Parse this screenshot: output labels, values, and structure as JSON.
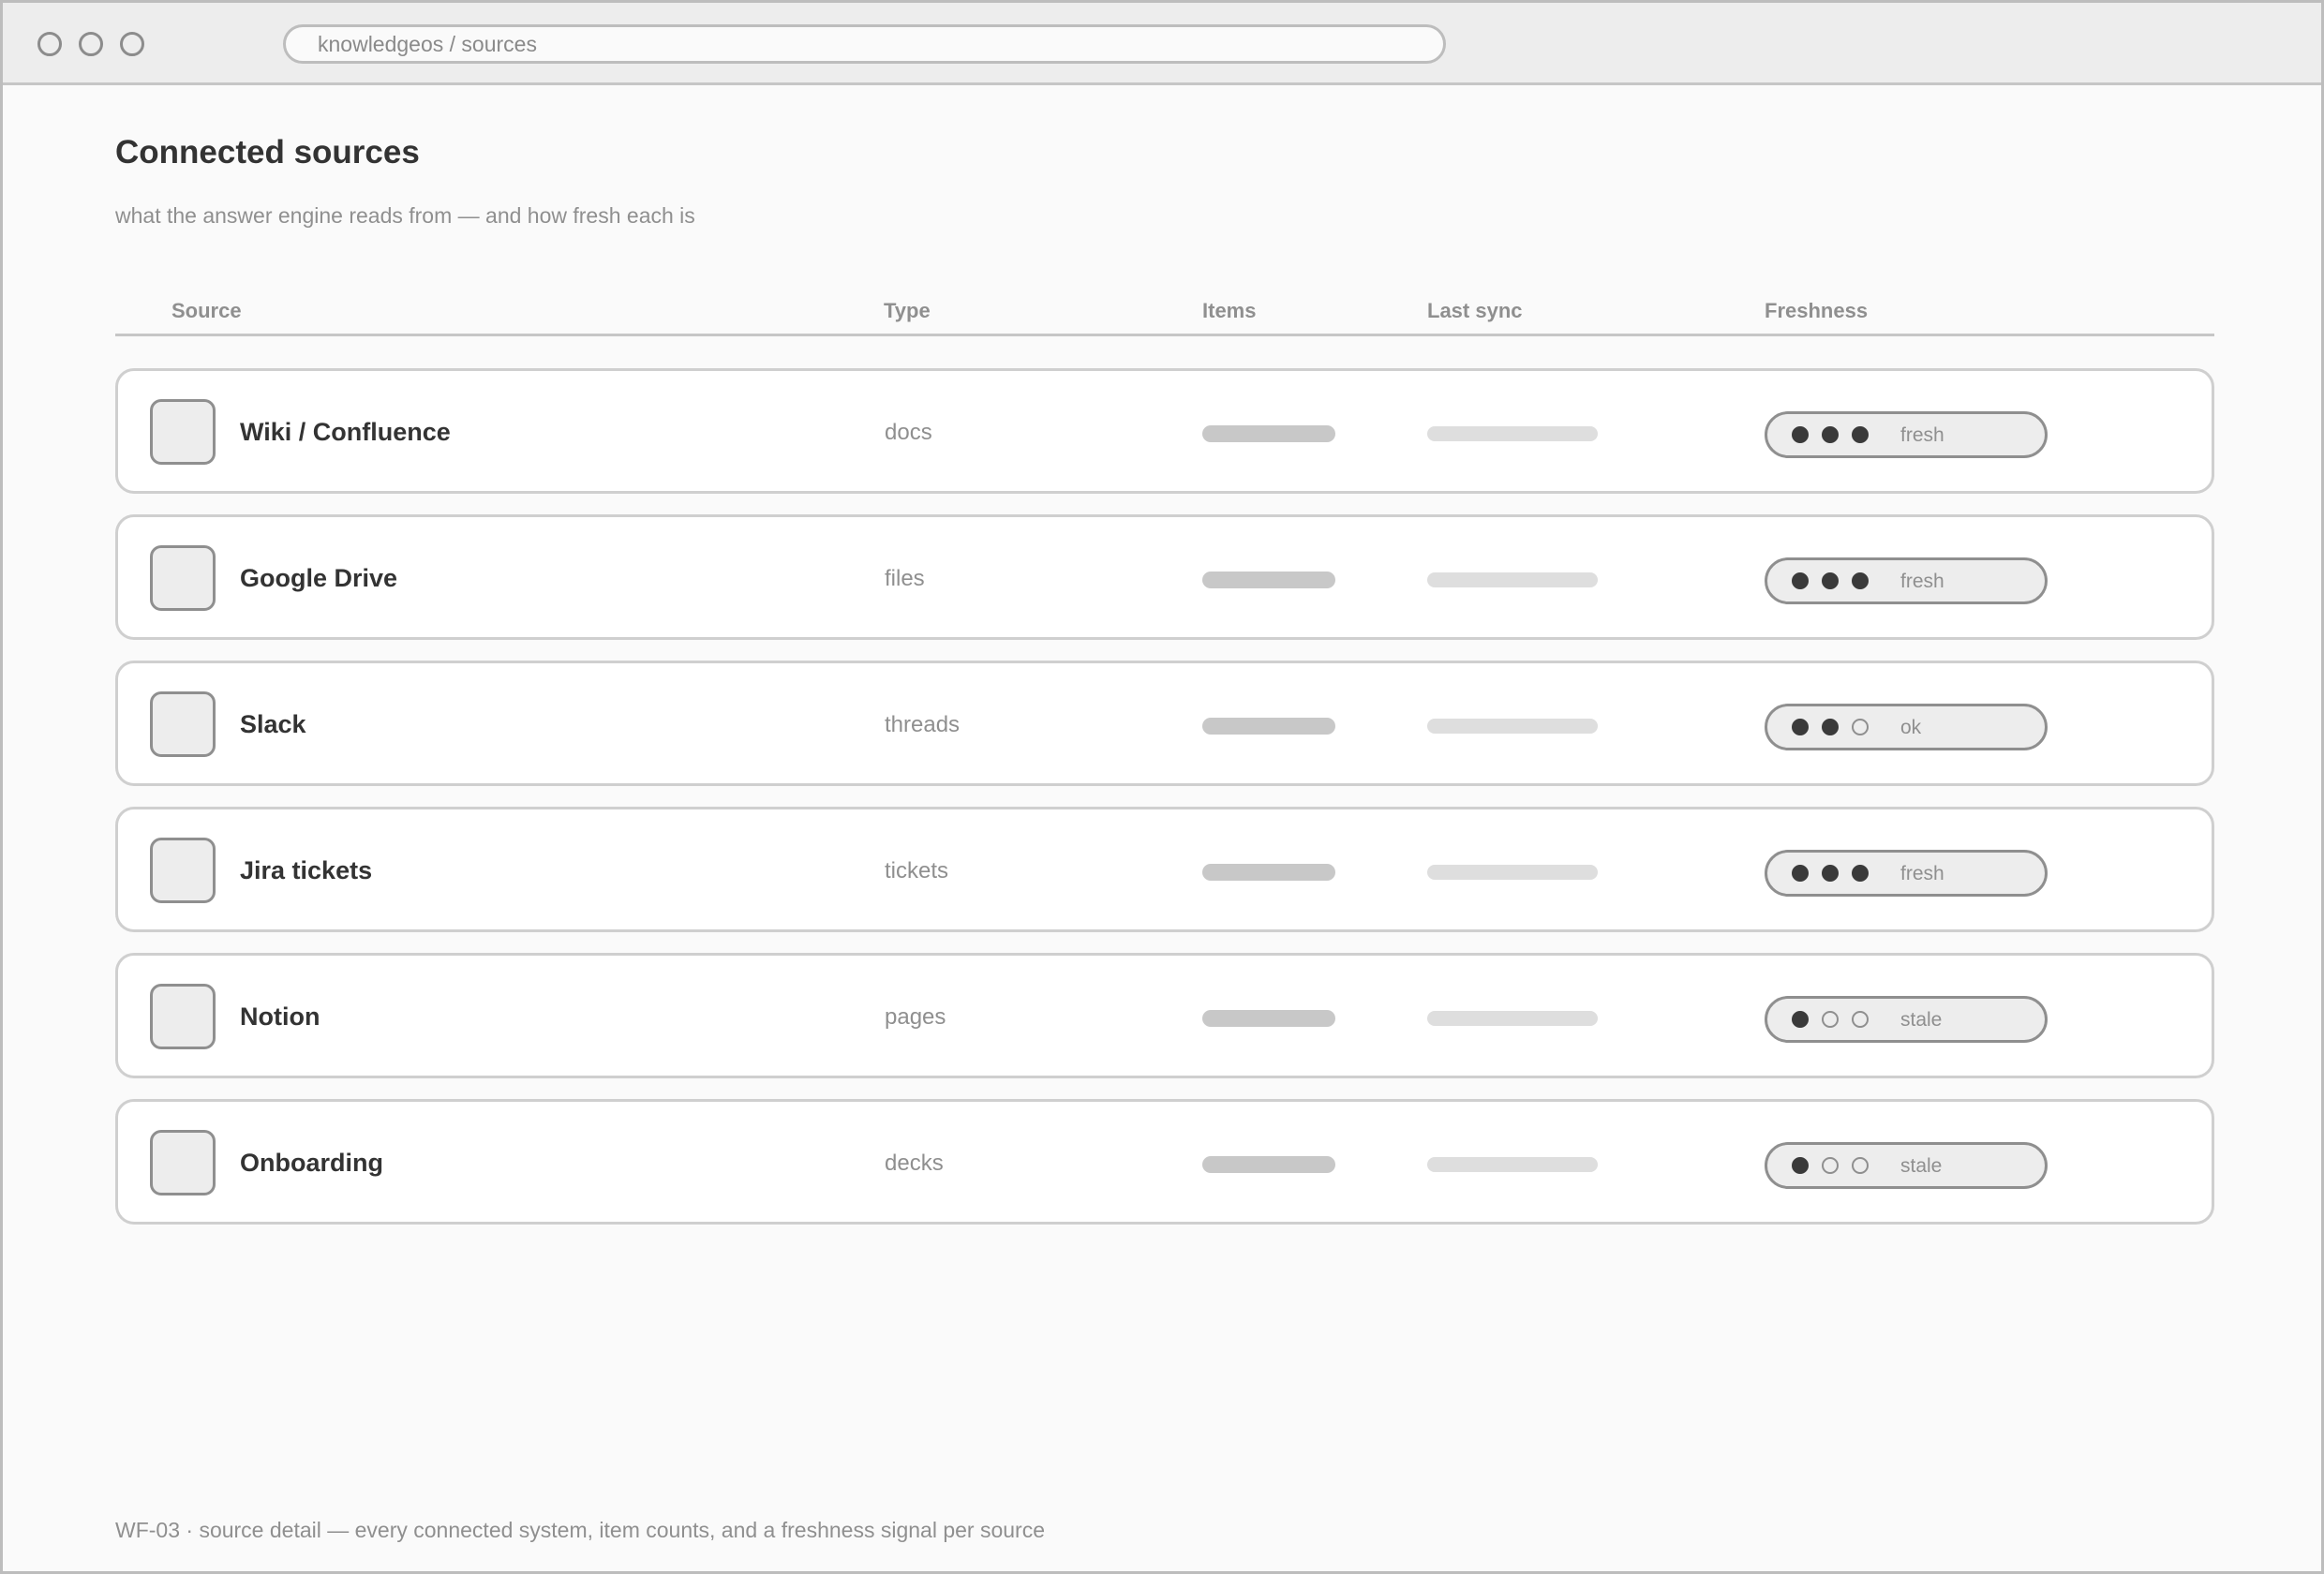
{
  "browser": {
    "address": "knowledgeos / sources"
  },
  "page": {
    "title": "Connected sources",
    "subtitle": "what the answer engine reads from — and how fresh each is"
  },
  "table": {
    "columns": {
      "source": "Source",
      "type": "Type",
      "items": "Items",
      "last_sync": "Last sync",
      "freshness": "Freshness"
    },
    "rows": [
      {
        "name": "Wiki / Confluence",
        "type": "docs",
        "freshness_label": "fresh",
        "freshness_level": 3,
        "freshness_max": 3
      },
      {
        "name": "Google Drive",
        "type": "files",
        "freshness_label": "fresh",
        "freshness_level": 3,
        "freshness_max": 3
      },
      {
        "name": "Slack",
        "type": "threads",
        "freshness_label": "ok",
        "freshness_level": 2,
        "freshness_max": 3
      },
      {
        "name": "Jira tickets",
        "type": "tickets",
        "freshness_label": "fresh",
        "freshness_level": 3,
        "freshness_max": 3
      },
      {
        "name": "Notion",
        "type": "pages",
        "freshness_label": "stale",
        "freshness_level": 1,
        "freshness_max": 3
      },
      {
        "name": "Onboarding",
        "type": "decks",
        "freshness_label": "stale",
        "freshness_level": 1,
        "freshness_max": 3
      }
    ]
  },
  "footer": {
    "note": "WF-03 · source detail — every connected system, item counts, and a freshness signal per source"
  }
}
